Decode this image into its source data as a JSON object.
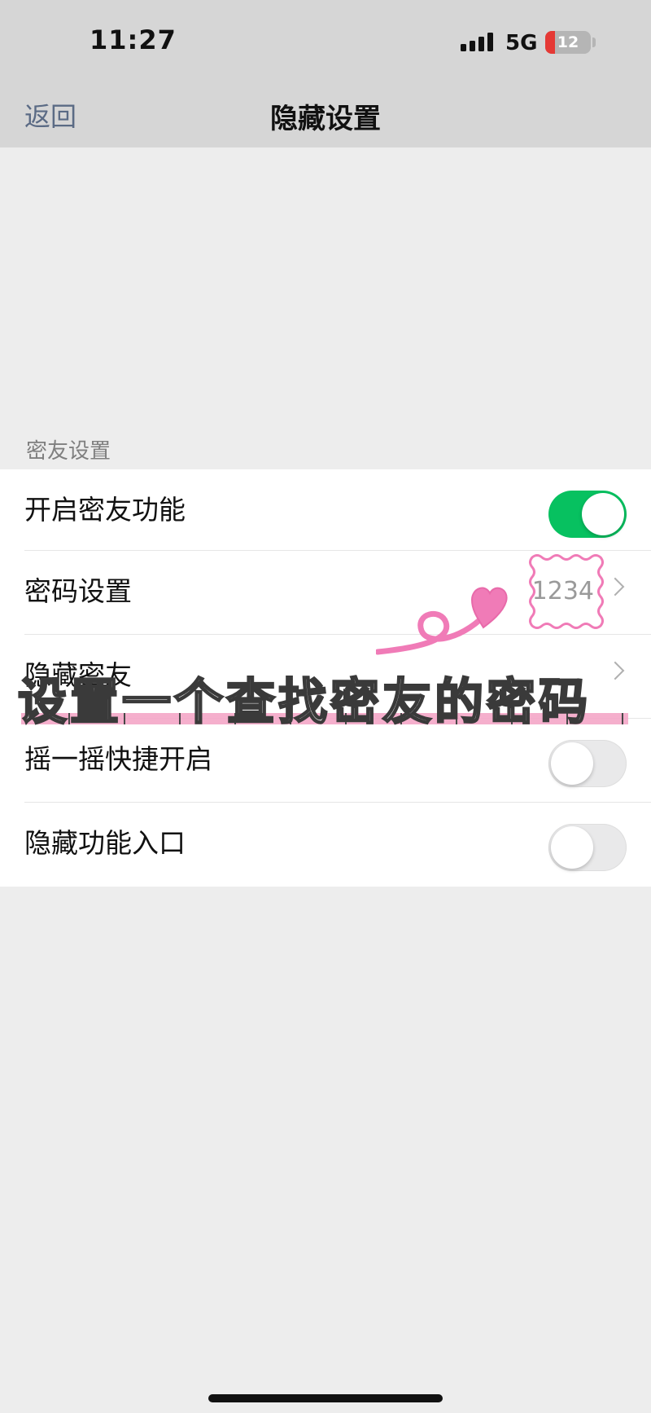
{
  "status_bar": {
    "time": "11:27",
    "network": "5G",
    "battery_level": "12",
    "battery_color": "#e53935"
  },
  "nav": {
    "back_label": "返回",
    "title": "隐藏设置"
  },
  "section": {
    "label": "密友设置"
  },
  "rows": [
    {
      "label": "开启密友功能",
      "control": "toggle",
      "state": "on"
    },
    {
      "label": "密码设置",
      "control": "value",
      "value": "1234"
    },
    {
      "label": "隐藏密友",
      "control": "chevron"
    },
    {
      "label": "摇一摇快捷开启",
      "control": "toggle",
      "state": "off"
    },
    {
      "label": "隐藏功能入口",
      "control": "toggle",
      "state": "off"
    }
  ],
  "overlay": {
    "caption": "设置一个查找密友的密码",
    "accent_color": "#f07bb7"
  },
  "colors": {
    "toggle_on": "#07c160",
    "nav_background": "#d6d6d6",
    "page_background": "#ededed"
  }
}
